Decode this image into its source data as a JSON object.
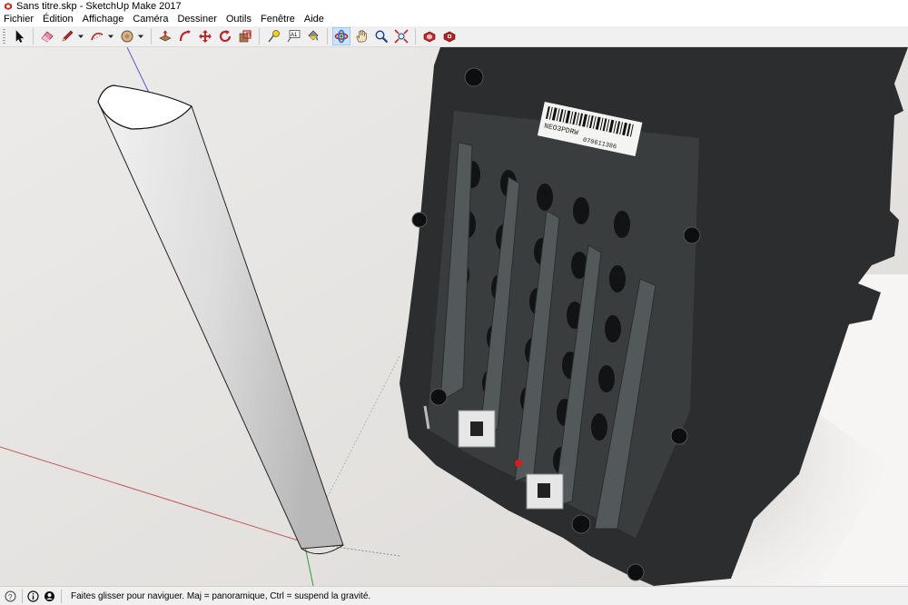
{
  "window": {
    "title": "Sans titre.skp - SketchUp Make 2017"
  },
  "menu": {
    "items": [
      "Fichier",
      "Édition",
      "Affichage",
      "Caméra",
      "Dessiner",
      "Outils",
      "Fenêtre",
      "Aide"
    ]
  },
  "toolbar": {
    "tools": [
      {
        "name": "select-tool",
        "icon": "arrow-cursor-icon"
      },
      {
        "name": "eraser-tool",
        "icon": "eraser-icon"
      },
      {
        "name": "line-tool",
        "icon": "pencil-icon"
      },
      {
        "name": "arc-tool",
        "icon": "arc-icon"
      },
      {
        "name": "shape-tool",
        "icon": "circle-icon"
      },
      {
        "name": "push-pull-tool",
        "icon": "push-pull-icon"
      },
      {
        "name": "follow-me-tool",
        "icon": "follow-me-icon"
      },
      {
        "name": "move-tool",
        "icon": "move-arrows-icon"
      },
      {
        "name": "rotate-tool",
        "icon": "rotate-icon"
      },
      {
        "name": "scale-tool",
        "icon": "scale-icon"
      },
      {
        "name": "tape-measure-tool",
        "icon": "tape-measure-icon"
      },
      {
        "name": "text-tool",
        "icon": "text-label-icon"
      },
      {
        "name": "paint-bucket-tool",
        "icon": "paint-bucket-icon"
      },
      {
        "name": "orbit-tool",
        "icon": "orbit-icon"
      },
      {
        "name": "pan-tool",
        "icon": "hand-icon"
      },
      {
        "name": "zoom-tool",
        "icon": "magnifier-icon"
      },
      {
        "name": "zoom-extents-tool",
        "icon": "zoom-extents-icon"
      },
      {
        "name": "warehouse-button",
        "icon": "3d-warehouse-icon"
      },
      {
        "name": "extension-warehouse-button",
        "icon": "extension-warehouse-icon"
      }
    ],
    "text_tool_glyph": "A1",
    "active_tool": "orbit-tool"
  },
  "statusbar": {
    "hint": "Faites glisser pour naviguer. Maj = panoramique, Ctrl =  suspend la gravité."
  },
  "viewport": {
    "background_color": "#e9e7e5",
    "objects": [
      "quarter-cylinder-model",
      "background-photo-speaker-grille"
    ],
    "photo_label": {
      "line1": "NEO3PDRW",
      "line2": "070611386"
    }
  }
}
